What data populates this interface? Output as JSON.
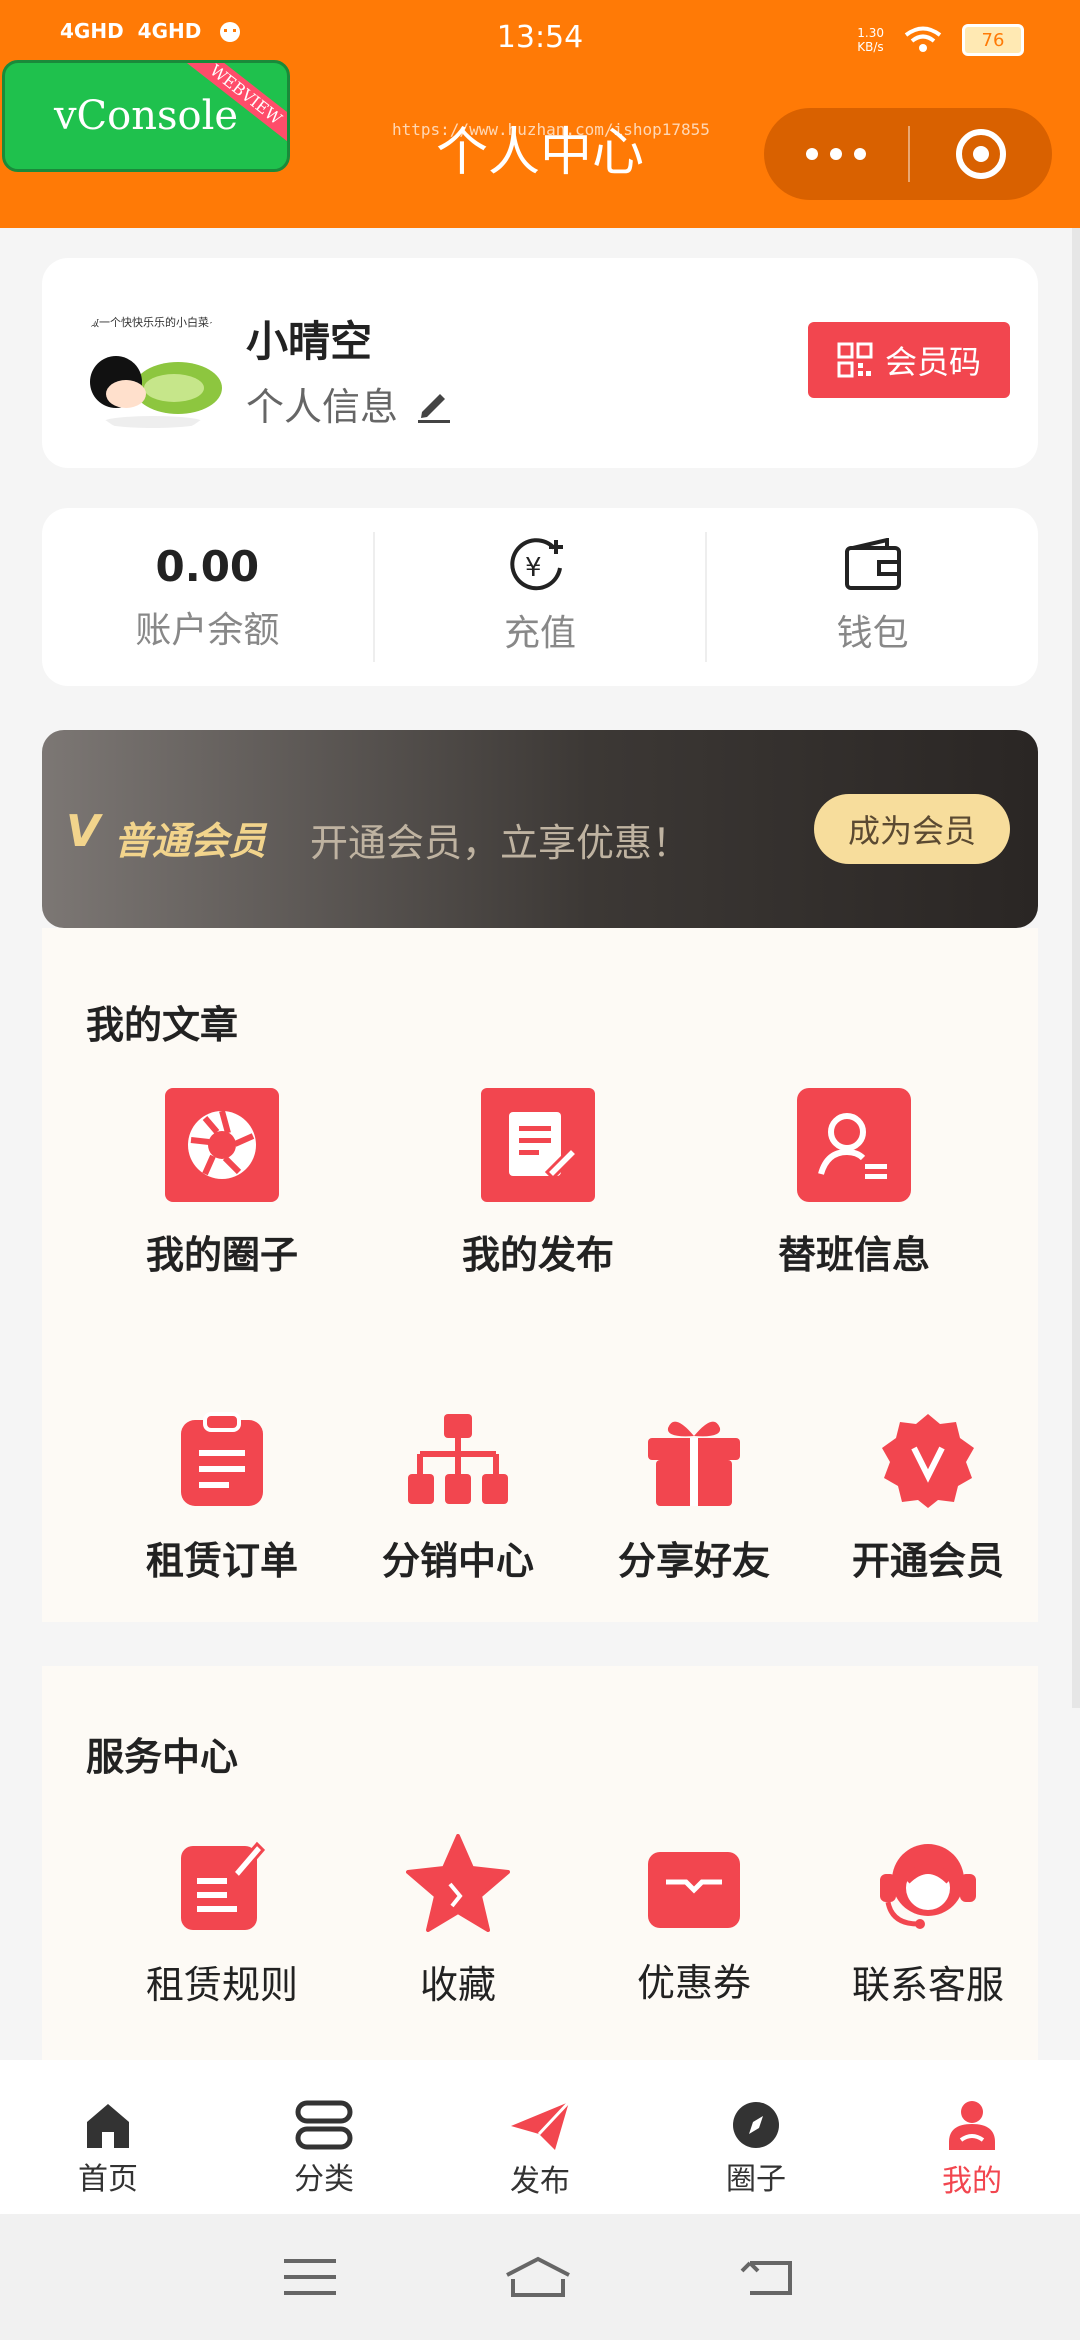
{
  "status_bar": {
    "time": "13:54",
    "signal_1": "4GHD",
    "signal_2": "4GHD",
    "net_speed": "1.30\nKB/s",
    "battery": "76"
  },
  "vconsole": {
    "label": "vConsole",
    "tag": "WEBVIEW"
  },
  "header": {
    "title": "个人中心",
    "watermark": "https://www.huzhan.com/ishop17855"
  },
  "profile": {
    "name": "小晴空",
    "info_label": "个人信息",
    "member_code_label": "会员码",
    "avatar_caption": "做一个快快乐乐的小白菜~"
  },
  "wallet": {
    "balance_value": "0.00",
    "balance_label": "账户余额",
    "recharge_label": "充值",
    "wallet_label": "钱包"
  },
  "vip": {
    "mark": "V",
    "level": "普通会员",
    "slogan": "开通会员，立享优惠！",
    "join_label": "成为会员"
  },
  "articles": {
    "title": "我的文章",
    "row1": [
      "我的圈子",
      "我的发布",
      "替班信息"
    ],
    "row2": [
      "租赁订单",
      "分销中心",
      "分享好友",
      "开通会员"
    ]
  },
  "services": {
    "title": "服务中心",
    "items": [
      "租赁规则",
      "收藏",
      "优惠券",
      "联系客服"
    ]
  },
  "tabbar": {
    "items": [
      "首页",
      "分类",
      "发布",
      "圈子",
      "我的"
    ],
    "active": "我的"
  },
  "colors": {
    "header": "#ff7a06",
    "accent": "#f2464f",
    "gold": "#f7dd9c"
  }
}
